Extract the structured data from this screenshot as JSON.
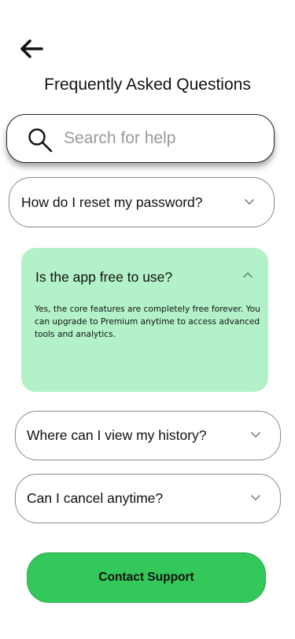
{
  "header": {
    "back_icon": "arrow-left-icon",
    "title": "Frequently Asked Questions"
  },
  "search": {
    "icon": "search-icon",
    "placeholder": "Search for help",
    "value": ""
  },
  "faqs": [
    {
      "question": "How do I reset my password?",
      "expanded": false,
      "icon": "chevron-down-icon"
    },
    {
      "question": "Is the app free to use?",
      "expanded": true,
      "icon": "chevron-up-icon",
      "answer": "Yes, the core features are completely free forever. You can upgrade to Premium anytime to access advanced tools and analytics."
    },
    {
      "question": "Where can I view my history?",
      "expanded": false,
      "icon": "chevron-down-icon"
    },
    {
      "question": "Can I cancel anytime?",
      "expanded": false,
      "icon": "chevron-down-icon"
    }
  ],
  "contact_button": {
    "label": "Contact Support"
  },
  "colors": {
    "expanded_bg": "#b3f2c9",
    "accent_green": "#34c85a",
    "border_gray": "#8a8a8a",
    "chevron_gray": "#8c8c8c"
  }
}
